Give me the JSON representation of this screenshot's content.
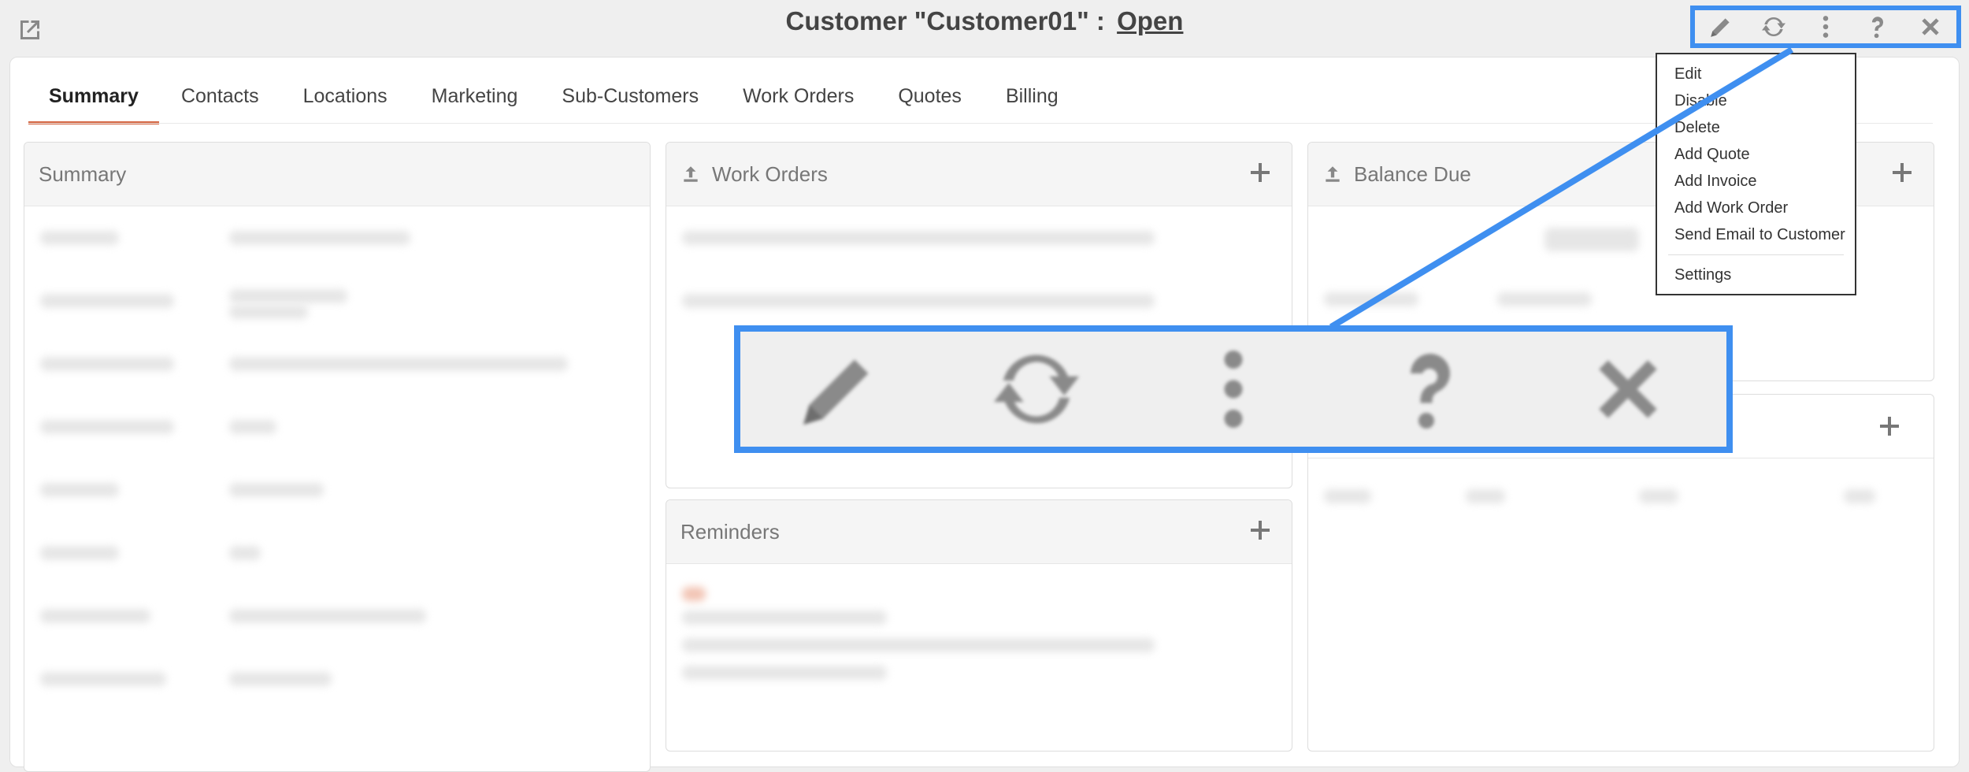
{
  "header": {
    "title": "Customer \"Customer01\" :",
    "status_link": "Open",
    "external_icon": "external-link-icon"
  },
  "toolbar": {
    "icons": [
      "pencil-icon",
      "refresh-icon",
      "more-vertical-icon",
      "help-icon",
      "close-icon"
    ]
  },
  "tabs": [
    {
      "label": "Summary",
      "active": true
    },
    {
      "label": "Contacts"
    },
    {
      "label": "Locations"
    },
    {
      "label": "Marketing"
    },
    {
      "label": "Sub-Customers"
    },
    {
      "label": "Work Orders"
    },
    {
      "label": "Quotes"
    },
    {
      "label": "Billing"
    }
  ],
  "panels": {
    "summary": {
      "title": "Summary"
    },
    "work_orders": {
      "title": "Work Orders"
    },
    "reminders": {
      "title": "Reminders"
    },
    "balance_due": {
      "title": "Balance Due"
    }
  },
  "menu": {
    "items": [
      "Edit",
      "Disable",
      "Delete",
      "Add Quote",
      "Add Invoice",
      "Add Work Order",
      "Send Email to Customer"
    ],
    "settings": "Settings"
  },
  "colors": {
    "highlight": "#3f8ff0",
    "active_tab": "#d5643f",
    "icon": "#8a8a8a"
  }
}
